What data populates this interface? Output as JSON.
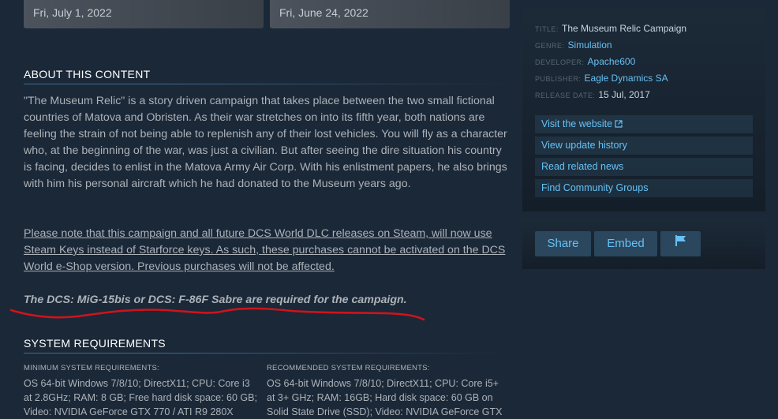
{
  "top_cards": [
    {
      "date": "Fri, July 1, 2022"
    },
    {
      "date": "Fri, June 24, 2022"
    }
  ],
  "about": {
    "heading": "ABOUT THIS CONTENT",
    "paragraph1": "\"The Museum Relic\" is a story driven campaign that takes place between the two small fictional countries of Matova and Obristen. As their war stretches on into its fifth year, both nations are feeling the strain of not being able to replenish any of their lost vehicles. You will fly as a character who, at the beginning of the war, was just a civilian. But after seeing the dire situation his country is facing, decides to enlist in the Matova Army Air Corp. With his enlistment papers, he also brings with him his personal aircraft which he had donated to the Museum years ago.",
    "paragraph2": "Please note that this campaign and all future DCS World DLC releases on Steam, will now use Steam Keys instead of Starforce keys. As such, these purchases cannot be activated on the DCS World e-Shop version. Previous purchases will not be affected.",
    "paragraph3": "The DCS: MiG-15bis or DCS: F-86F Sabre are required for the campaign."
  },
  "sysreq": {
    "heading": "SYSTEM REQUIREMENTS",
    "minimum": {
      "title": "MINIMUM SYSTEM REQUIREMENTS:",
      "text": "OS 64-bit Windows 7/8/10; DirectX11; CPU: Core i3 at 2.8GHz; RAM: 8 GB; Free hard disk space: 60 GB; Video: NVIDIA GeForce GTX 770 / ATI R9 280X"
    },
    "recommended": {
      "title": "RECOMMENDED SYSTEM REQUIREMENTS:",
      "text": "OS 64-bit Windows 7/8/10; DirectX11; CPU: Core i5+ at 3+ GHz; RAM: 16GB; Hard disk space: 60 GB on Solid State Drive (SSD); Video: NVIDIA GeForce GTX"
    }
  },
  "details": {
    "title_label": "TITLE:",
    "title_value": "The Museum Relic Campaign",
    "genre_label": "GENRE:",
    "genre_value": "Simulation",
    "developer_label": "DEVELOPER:",
    "developer_value": "Apache600",
    "publisher_label": "PUBLISHER:",
    "publisher_value": "Eagle Dynamics SA",
    "release_label": "RELEASE DATE:",
    "release_value": "15 Jul, 2017"
  },
  "links": {
    "website": "Visit the website",
    "update_history": "View update history",
    "news": "Read related news",
    "groups": "Find Community Groups"
  },
  "share": {
    "share_label": "Share",
    "embed_label": "Embed",
    "flag_icon": "flag-icon"
  },
  "colors": {
    "background": "#1b2838",
    "link": "#67c1f5",
    "annotation_red": "#d0131b"
  }
}
